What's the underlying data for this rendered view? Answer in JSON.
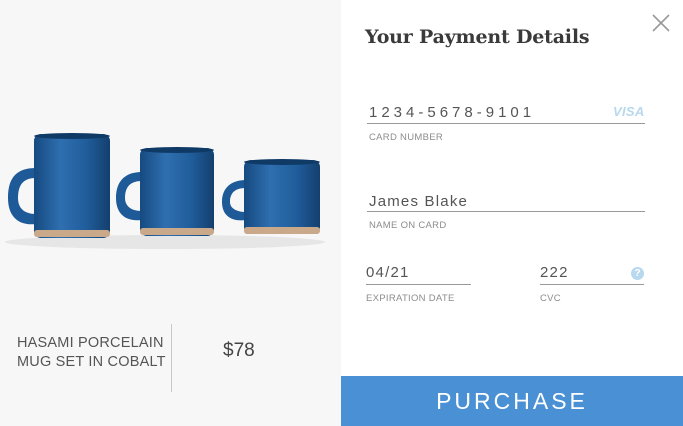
{
  "product": {
    "name": "HASAMI PORCELAIN MUG SET IN COBALT",
    "price": "$78"
  },
  "payment": {
    "title": "Your Payment Details",
    "card_number": {
      "value": "1234-5678-9101",
      "label": "CARD NUMBER",
      "brand": "VISA"
    },
    "name_on_card": {
      "value": "James Blake",
      "label": "NAME ON CARD"
    },
    "expiration": {
      "value": "04/21",
      "label": "EXPIRATION DATE"
    },
    "cvc": {
      "value": "222",
      "label": "CVC",
      "help": "?"
    },
    "purchase_label": "PURCHASE"
  },
  "colors": {
    "accent": "#4a90d4",
    "mug": "#1f5c9a",
    "visa_light": "#b8d8ee"
  },
  "icons": {
    "close": "close-icon",
    "help": "help-icon"
  }
}
